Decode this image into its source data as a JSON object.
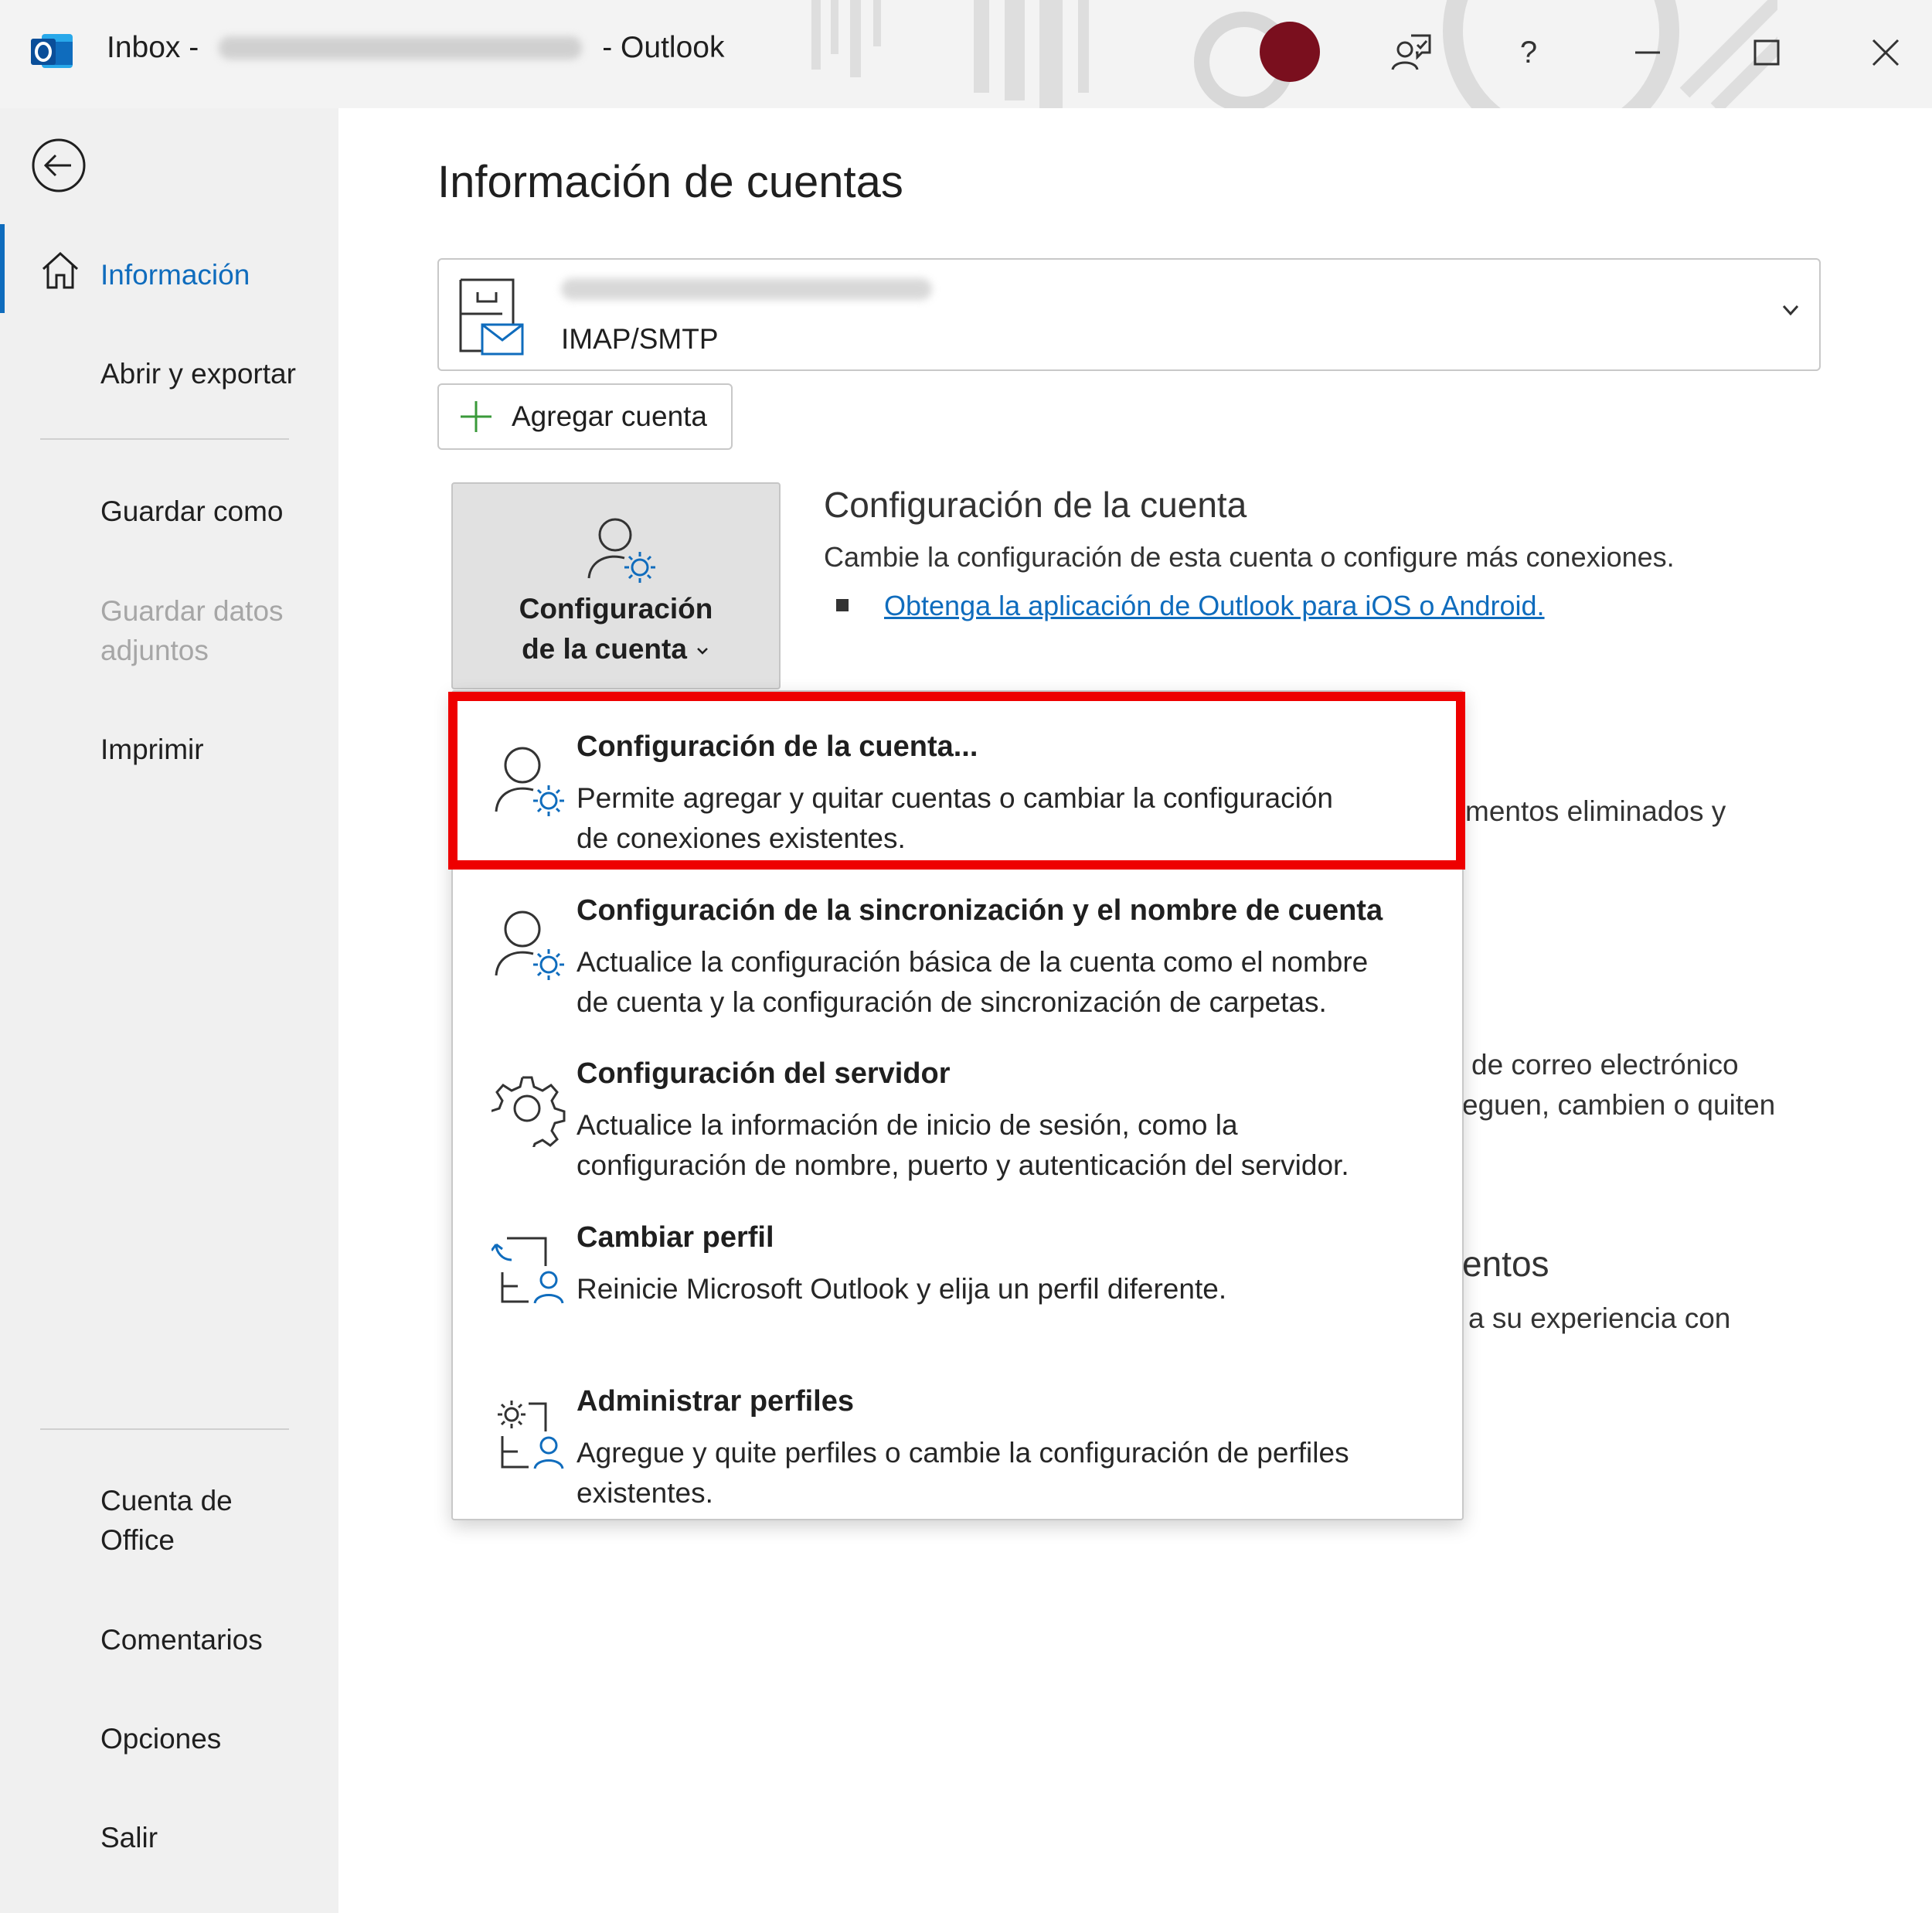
{
  "window": {
    "title_prefix": "Inbox -",
    "title_suffix": "-  Outlook",
    "buttons": {
      "feedback": "feedback-icon",
      "help": "?",
      "minimize": "minimize-icon",
      "maximize": "maximize-icon",
      "close": "close-icon"
    },
    "colors": {
      "avatar": "#7a0f1e",
      "accent": "#0f6cbd",
      "highlight": "#ee0000"
    }
  },
  "nav": {
    "back": "back-arrow-icon",
    "items": [
      {
        "label": "Información",
        "active": true
      },
      {
        "label": "Abrir y exportar"
      },
      {
        "label": "Guardar como"
      },
      {
        "label": "Guardar datos"
      },
      {
        "label": "adjuntos"
      },
      {
        "label": "Imprimir"
      },
      {
        "label": "Cuenta de"
      },
      {
        "label": "Office"
      },
      {
        "label": "Comentarios"
      },
      {
        "label": "Opciones"
      },
      {
        "label": "Salir"
      }
    ]
  },
  "main": {
    "page_title": "Información de cuentas",
    "account": {
      "type": "IMAP/SMTP"
    },
    "add_account": "Agregar cuenta",
    "config_tile": {
      "line1": "Configuración",
      "line2": "de la cuenta"
    },
    "section": {
      "title": "Configuración de la cuenta",
      "desc": "Cambie la configuración de esta cuenta o configure más conexiones.",
      "link": "Obtenga la aplicación de Outlook para iOS o Android."
    },
    "background_fragments": {
      "frag1": "mentos eliminados y",
      "frag2": "de correo electrónico",
      "frag3": "eguen, cambien o quiten",
      "frag4": "entos",
      "frag5": "a su experiencia con"
    }
  },
  "dropdown": {
    "items": [
      {
        "title": "Configuración de la cuenta...",
        "line1": "Permite agregar y quitar cuentas o cambiar la configuración",
        "line2": "de conexiones existentes."
      },
      {
        "title": "Configuración de la sincronización y el nombre de cuenta",
        "line1": "Actualice la configuración básica de la cuenta como el nombre",
        "line2": "de cuenta y la configuración de sincronización de carpetas."
      },
      {
        "title": "Configuración del servidor",
        "line1": "Actualice la información de inicio de sesión, como la",
        "line2": "configuración de nombre, puerto y autenticación del servidor."
      },
      {
        "title": "Cambiar perfil",
        "line1": "Reinicie Microsoft Outlook y elija un perfil diferente.",
        "line2": ""
      },
      {
        "title": "Administrar perfiles",
        "line1": "Agregue y quite perfiles o cambie la configuración de perfiles",
        "line2": "existentes."
      }
    ]
  }
}
